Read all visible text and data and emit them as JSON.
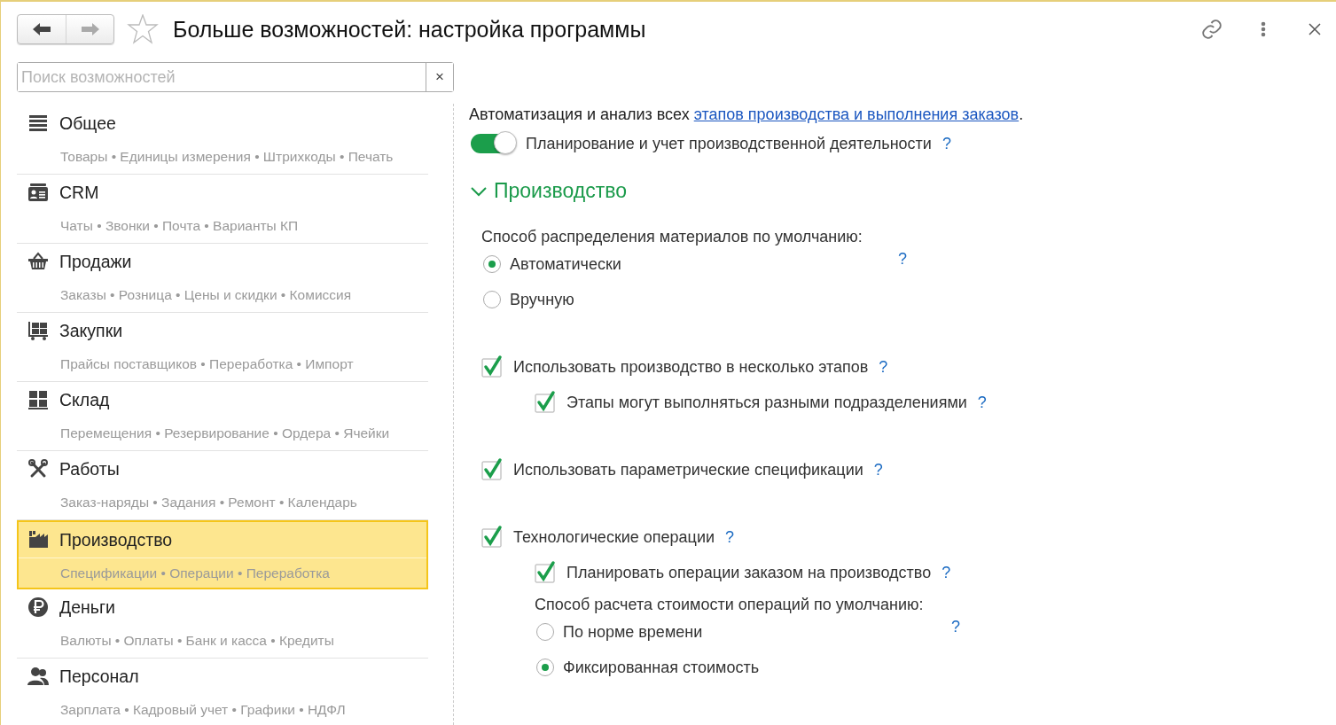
{
  "nav_buttons": [
    {
      "kind": "back",
      "disabled": false
    },
    {
      "kind": "forward",
      "disabled": true
    }
  ],
  "favorite": {
    "selected": false
  },
  "title": "Больше возможностей: настройка программы",
  "search": {
    "placeholder": "Поиск возможностей",
    "clear": "×"
  },
  "sidebar": {
    "items": [
      {
        "title": "Общее",
        "subtitle": "Товары • Единицы измерения • Штрихкоды • Печать",
        "selected": false
      },
      {
        "title": "CRM",
        "subtitle": "Чаты • Звонки • Почта • Варианты КП",
        "selected": false
      },
      {
        "title": "Продажи",
        "subtitle": "Заказы • Розница • Цены и скидки • Комиссия",
        "selected": false
      },
      {
        "title": "Закупки",
        "subtitle": "Прайсы поставщиков • Переработка • Импорт",
        "selected": false
      },
      {
        "title": "Склад",
        "subtitle": "Перемещения • Резервирование • Ордера • Ячейки",
        "selected": false
      },
      {
        "title": "Работы",
        "subtitle": "Заказ-наряды • Задания • Ремонт • Календарь",
        "selected": false
      },
      {
        "title": "Производство",
        "subtitle": "Спецификации • Операции • Переработка",
        "selected": true
      },
      {
        "title": "Деньги",
        "subtitle": "Валюты • Оплаты • Банк и касса • Кредиты",
        "selected": false
      },
      {
        "title": "Персонал",
        "subtitle": "Зарплата • Кадровый учет • Графики • НДФЛ",
        "selected": false
      }
    ]
  },
  "content": {
    "intro": {
      "text": "Автоматизация и анализ всех ",
      "link": "этапов производства и выполнения заказов",
      "after": "."
    },
    "toggle": {
      "label": "Планирование и учет производственной деятельности",
      "on": true,
      "help": "?"
    },
    "section": {
      "title": "Производство",
      "expanded": true,
      "settings": [
        {
          "kind": "radio_group",
          "label": "Способ распределения материалов по умолчанию:",
          "help": "?",
          "options": [
            {
              "label": "Автоматически",
              "selected": true
            },
            {
              "label": "Вручную",
              "selected": false
            }
          ]
        },
        {
          "kind": "checkbox",
          "label": "Использовать производство в несколько этапов",
          "checked": true,
          "help": "?",
          "children": [
            {
              "kind": "checkbox",
              "label": "Этапы могут выполняться разными подразделениями",
              "checked": true,
              "help": "?"
            }
          ]
        },
        {
          "kind": "checkbox",
          "label": "Использовать параметрические спецификации",
          "checked": true,
          "help": "?"
        },
        {
          "kind": "checkbox",
          "label": "Технологические операции",
          "checked": true,
          "help": "?",
          "children": [
            {
              "kind": "checkbox",
              "label": "Планировать операции заказом на производство",
              "checked": true,
              "help": "?"
            },
            {
              "kind": "radio_group",
              "label": "Способ расчета стоимости операций по умолчанию:",
              "help": "?",
              "options": [
                {
                  "label": "По норме времени",
                  "selected": false
                },
                {
                  "label": "Фиксированная стоимость",
                  "selected": true
                }
              ]
            }
          ]
        }
      ]
    }
  }
}
